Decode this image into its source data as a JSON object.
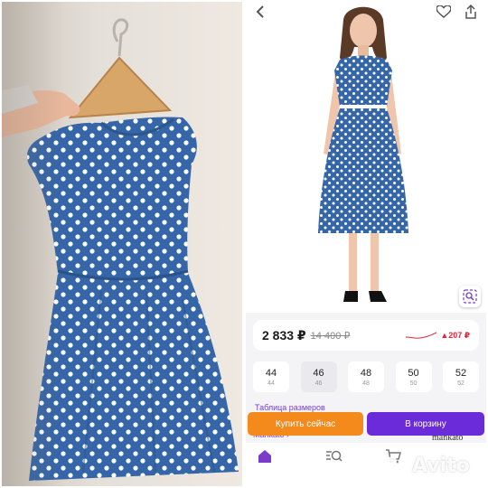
{
  "product": {
    "price_current": "2 833 ₽",
    "price_old": "14 400 ₽",
    "price_change": "▲207 ₽"
  },
  "sizes": [
    {
      "label": "44",
      "sub": "44"
    },
    {
      "label": "46",
      "sub": "46"
    },
    {
      "label": "48",
      "sub": "48"
    },
    {
      "label": "50",
      "sub": "50"
    },
    {
      "label": "52",
      "sub": "52"
    }
  ],
  "selected_size": "46",
  "links": {
    "size_table": "Таблица размеров",
    "brand": "Mankato ›"
  },
  "buttons": {
    "buy_now": "Купить сейчас",
    "add_to_cart": "В корзину"
  },
  "brand_logo": "mankato",
  "watermark": "Avito",
  "icons": {
    "back": "chevron-left-icon",
    "favorite": "heart-icon",
    "share": "share-icon",
    "visual_search": "photo-search-icon",
    "home": "home-icon",
    "search": "search-icon",
    "cart": "cart-icon"
  },
  "colors": {
    "dress": "#3566a8",
    "buy_button": "#f48a1c",
    "cart_button": "#6c2bd9",
    "link": "#7a3cc8",
    "price_up": "#e0263a"
  }
}
